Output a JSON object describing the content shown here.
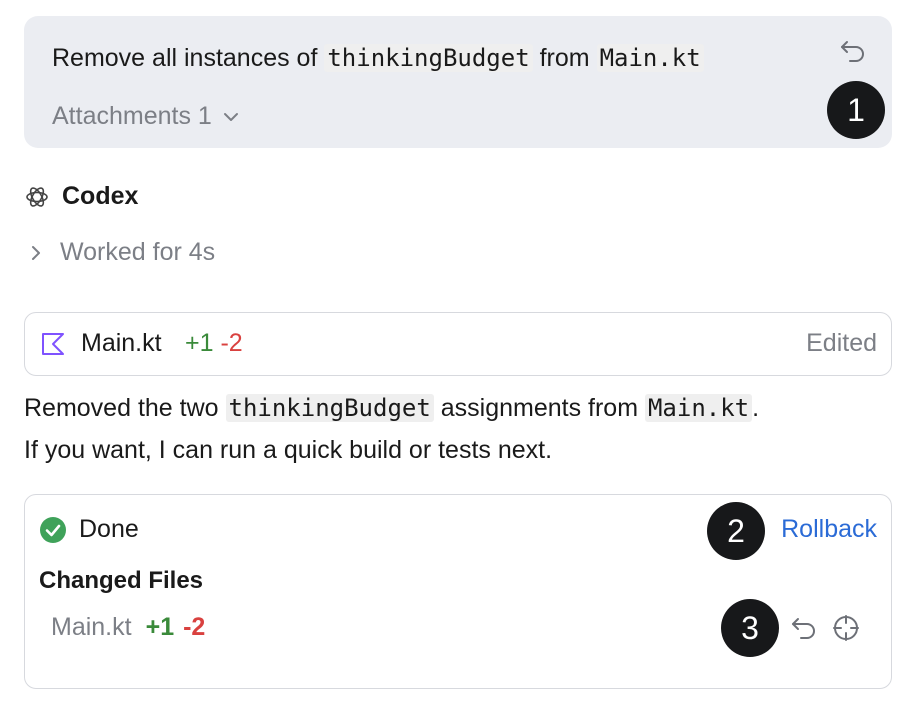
{
  "message": {
    "text_before": "Remove all instances of ",
    "code1": "thinkingBudget",
    "text_mid": " from ",
    "code2": "Main.kt",
    "attachments_label": "Attachments 1"
  },
  "badges": {
    "b1": "1",
    "b2": "2",
    "b3": "3"
  },
  "codex": {
    "name": "Codex",
    "worked": "Worked for 4s"
  },
  "file_card": {
    "filename": "Main.kt",
    "added": "+1",
    "removed": "-2",
    "status": "Edited"
  },
  "response": {
    "line1_before": "Removed the two ",
    "line1_code1": "thinkingBudget",
    "line1_mid": " assignments from ",
    "line1_code2": "Main.kt",
    "line1_end": ".",
    "line2": "If you want, I can run a quick build or tests next."
  },
  "done_card": {
    "status": "Done",
    "rollback_label": "Rollback",
    "changed_title": "Changed Files",
    "file": "Main.kt",
    "added": "+1",
    "removed": "-2"
  },
  "colors": {
    "accent_link": "#2b6bd6",
    "added": "#3a8a3a",
    "removed": "#d9413f",
    "done_check": "#3fa25a",
    "kotlin_icon": "#7f52ff"
  },
  "icons": [
    "undo-icon",
    "chevron-down-icon",
    "codex-logo-icon",
    "chevron-right-icon",
    "kotlin-file-icon",
    "check-circle-icon",
    "target-icon"
  ]
}
